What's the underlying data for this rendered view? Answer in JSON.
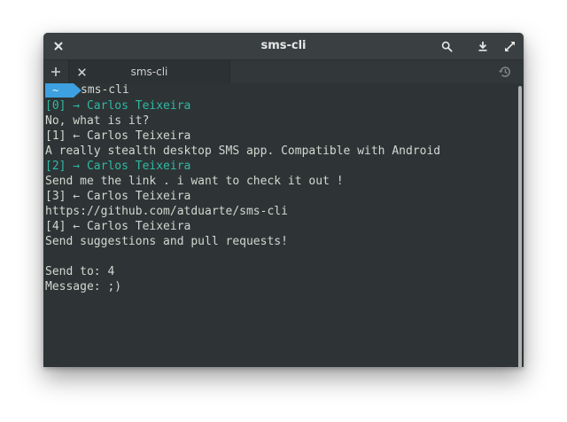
{
  "window": {
    "title": "sms-cli"
  },
  "tabs": [
    {
      "label": "sms-cli",
      "active": true
    }
  ],
  "prompt": {
    "badge": "~",
    "command": "sms-cli"
  },
  "messages": [
    {
      "header": "[0] → Carlos Teixeira",
      "direction": "sent",
      "body": "No, what is it?"
    },
    {
      "header": "[1] ← Carlos Teixeira",
      "direction": "received",
      "body": "A really stealth desktop SMS app. Compatible with Android"
    },
    {
      "header": "[2] → Carlos Teixeira",
      "direction": "sent",
      "body": "Send me the link . i want to check it out !"
    },
    {
      "header": "[3] ← Carlos Teixeira",
      "direction": "received",
      "body": "https://github.com/atduarte/sms-cli"
    },
    {
      "header": "[4] ← Carlos Teixeira",
      "direction": "received",
      "body": "Send suggestions and pull requests!"
    }
  ],
  "input": {
    "send_to": "Send to: 4",
    "message": "Message: ;)"
  },
  "icons": {
    "close": "close-icon",
    "search": "search-icon",
    "download": "download-icon",
    "fullscreen": "fullscreen-icon",
    "new_tab": "plus-icon",
    "tab_close": "close-icon",
    "history": "history-icon"
  },
  "colors": {
    "background": "#2e3436",
    "titlebar": "#3a4042",
    "sent_text": "#2fb9a3",
    "default_text": "#d3d7cf",
    "prompt_badge": "#3da0e0"
  }
}
